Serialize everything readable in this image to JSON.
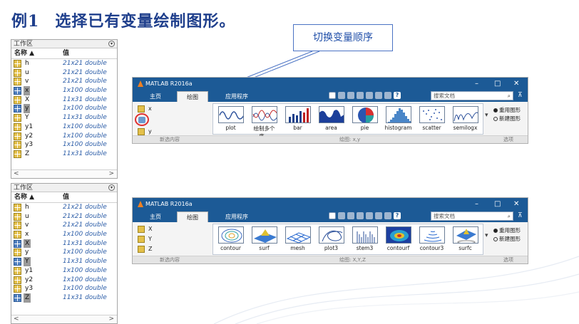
{
  "heading": {
    "label": "例1",
    "text": "选择已有变量绘制图形。"
  },
  "callout": "切换变量顺序",
  "workspace_panels": [
    {
      "title": "工作区",
      "col_name": "名称 ▲",
      "col_value": "值",
      "rows": [
        {
          "name": "h",
          "value": "21x21 double",
          "selected": false
        },
        {
          "name": "u",
          "value": "21x21 double",
          "selected": false
        },
        {
          "name": "v",
          "value": "21x21 double",
          "selected": false
        },
        {
          "name": "x",
          "value": "1x100 double",
          "selected": true
        },
        {
          "name": "X",
          "value": "11x31 double",
          "selected": false
        },
        {
          "name": "y",
          "value": "1x100 double",
          "selected": true
        },
        {
          "name": "Y",
          "value": "11x31 double",
          "selected": false
        },
        {
          "name": "y1",
          "value": "1x100 double",
          "selected": false
        },
        {
          "name": "y2",
          "value": "1x100 double",
          "selected": false
        },
        {
          "name": "y3",
          "value": "1x100 double",
          "selected": false
        },
        {
          "name": "Z",
          "value": "11x31 double",
          "selected": false
        }
      ]
    },
    {
      "title": "工作区",
      "col_name": "名称 ▲",
      "col_value": "值",
      "rows": [
        {
          "name": "h",
          "value": "21x21 double",
          "selected": false
        },
        {
          "name": "u",
          "value": "21x21 double",
          "selected": false
        },
        {
          "name": "v",
          "value": "21x21 double",
          "selected": false
        },
        {
          "name": "x",
          "value": "1x100 double",
          "selected": false
        },
        {
          "name": "X",
          "value": "11x31 double",
          "selected": true
        },
        {
          "name": "y",
          "value": "1x100 double",
          "selected": false
        },
        {
          "name": "Y",
          "value": "11x31 double",
          "selected": true
        },
        {
          "name": "y1",
          "value": "1x100 double",
          "selected": false
        },
        {
          "name": "y2",
          "value": "1x100 double",
          "selected": false
        },
        {
          "name": "y3",
          "value": "1x100 double",
          "selected": false
        },
        {
          "name": "Z",
          "value": "11x31 double",
          "selected": true
        }
      ]
    }
  ],
  "matlab_windows": [
    {
      "title": "MATLAB R2016a",
      "tabs": [
        "主页",
        "绘图",
        "应用程序"
      ],
      "active_tab": 1,
      "search_placeholder": "搜索文档",
      "variables": [
        "x",
        "y"
      ],
      "plots": [
        "plot",
        "绘制多个序...",
        "bar",
        "area",
        "pie",
        "histogram",
        "scatter",
        "semilogx"
      ],
      "options": [
        "重用图形",
        "新建图形"
      ],
      "sections": [
        "新选内容",
        "绘图: x,y",
        "选项"
      ]
    },
    {
      "title": "MATLAB R2016a",
      "tabs": [
        "主页",
        "绘图",
        "应用程序"
      ],
      "active_tab": 1,
      "search_placeholder": "搜索文档",
      "variables": [
        "X",
        "Y",
        "Z"
      ],
      "plots": [
        "contour",
        "surf",
        "mesh",
        "plot3",
        "stem3",
        "contourf",
        "contour3",
        "surfc"
      ],
      "options": [
        "重用图形",
        "新建图形"
      ],
      "sections": [
        "新选内容",
        "绘图: X,Y,Z",
        "选项"
      ]
    }
  ],
  "window_buttons": {
    "min": "–",
    "max": "□",
    "close": "✕"
  },
  "colors": {
    "title": "#1f3f8c",
    "matlab_bar": "#1c5a96",
    "value_text": "#2d5ea8",
    "highlight_circle": "#e03030"
  }
}
